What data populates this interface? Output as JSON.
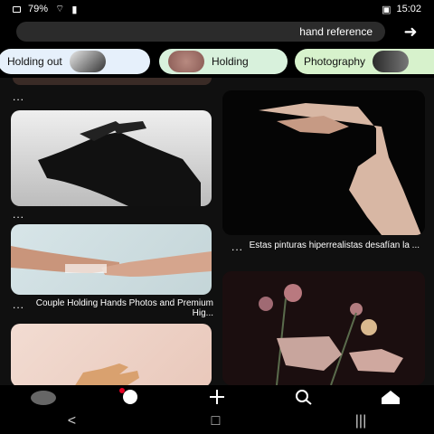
{
  "status_bar": {
    "time": "15:02",
    "battery": "79%"
  },
  "search": {
    "query": "hand reference"
  },
  "chips": [
    {
      "label": "Photography"
    },
    {
      "label": "Holding"
    },
    {
      "label": "Holding out"
    }
  ],
  "pins": [
    {
      "title": "Estas pinturas hiperrealistas desafían la ..."
    },
    {
      "title": "Couple Holding Hands Photos and Premium Hig..."
    }
  ],
  "more_label": "...",
  "icons": {
    "back": "back-arrow-icon",
    "nav": [
      "home-icon",
      "search-icon",
      "add-icon",
      "messages-icon",
      "profile-icon"
    ],
    "system": [
      "recent-apps-icon",
      "home-button-icon",
      "back-button-icon"
    ]
  },
  "colors": {
    "background": "#000000",
    "chip_green": "#d8f1dc",
    "chip_blue": "#e6f0fb",
    "notification_dot": "#e60023"
  }
}
